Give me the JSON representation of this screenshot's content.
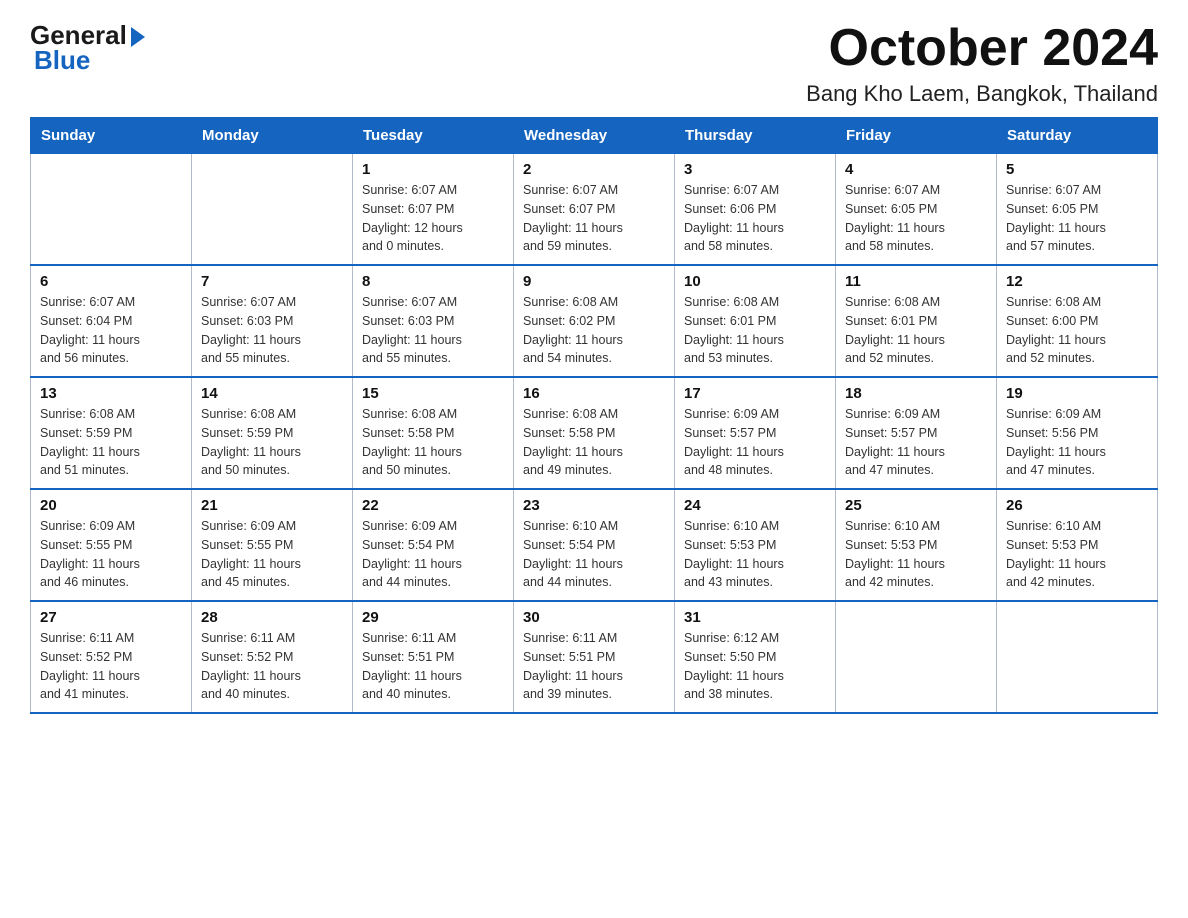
{
  "header": {
    "logo": {
      "text_general": "General",
      "triangle": "▶",
      "text_blue": "Blue"
    },
    "title": "October 2024",
    "subtitle": "Bang Kho Laem, Bangkok, Thailand"
  },
  "calendar": {
    "days_of_week": [
      "Sunday",
      "Monday",
      "Tuesday",
      "Wednesday",
      "Thursday",
      "Friday",
      "Saturday"
    ],
    "weeks": [
      {
        "days": [
          {
            "number": "",
            "info": ""
          },
          {
            "number": "",
            "info": ""
          },
          {
            "number": "1",
            "info": "Sunrise: 6:07 AM\nSunset: 6:07 PM\nDaylight: 12 hours\nand 0 minutes."
          },
          {
            "number": "2",
            "info": "Sunrise: 6:07 AM\nSunset: 6:07 PM\nDaylight: 11 hours\nand 59 minutes."
          },
          {
            "number": "3",
            "info": "Sunrise: 6:07 AM\nSunset: 6:06 PM\nDaylight: 11 hours\nand 58 minutes."
          },
          {
            "number": "4",
            "info": "Sunrise: 6:07 AM\nSunset: 6:05 PM\nDaylight: 11 hours\nand 58 minutes."
          },
          {
            "number": "5",
            "info": "Sunrise: 6:07 AM\nSunset: 6:05 PM\nDaylight: 11 hours\nand 57 minutes."
          }
        ]
      },
      {
        "days": [
          {
            "number": "6",
            "info": "Sunrise: 6:07 AM\nSunset: 6:04 PM\nDaylight: 11 hours\nand 56 minutes."
          },
          {
            "number": "7",
            "info": "Sunrise: 6:07 AM\nSunset: 6:03 PM\nDaylight: 11 hours\nand 55 minutes."
          },
          {
            "number": "8",
            "info": "Sunrise: 6:07 AM\nSunset: 6:03 PM\nDaylight: 11 hours\nand 55 minutes."
          },
          {
            "number": "9",
            "info": "Sunrise: 6:08 AM\nSunset: 6:02 PM\nDaylight: 11 hours\nand 54 minutes."
          },
          {
            "number": "10",
            "info": "Sunrise: 6:08 AM\nSunset: 6:01 PM\nDaylight: 11 hours\nand 53 minutes."
          },
          {
            "number": "11",
            "info": "Sunrise: 6:08 AM\nSunset: 6:01 PM\nDaylight: 11 hours\nand 52 minutes."
          },
          {
            "number": "12",
            "info": "Sunrise: 6:08 AM\nSunset: 6:00 PM\nDaylight: 11 hours\nand 52 minutes."
          }
        ]
      },
      {
        "days": [
          {
            "number": "13",
            "info": "Sunrise: 6:08 AM\nSunset: 5:59 PM\nDaylight: 11 hours\nand 51 minutes."
          },
          {
            "number": "14",
            "info": "Sunrise: 6:08 AM\nSunset: 5:59 PM\nDaylight: 11 hours\nand 50 minutes."
          },
          {
            "number": "15",
            "info": "Sunrise: 6:08 AM\nSunset: 5:58 PM\nDaylight: 11 hours\nand 50 minutes."
          },
          {
            "number": "16",
            "info": "Sunrise: 6:08 AM\nSunset: 5:58 PM\nDaylight: 11 hours\nand 49 minutes."
          },
          {
            "number": "17",
            "info": "Sunrise: 6:09 AM\nSunset: 5:57 PM\nDaylight: 11 hours\nand 48 minutes."
          },
          {
            "number": "18",
            "info": "Sunrise: 6:09 AM\nSunset: 5:57 PM\nDaylight: 11 hours\nand 47 minutes."
          },
          {
            "number": "19",
            "info": "Sunrise: 6:09 AM\nSunset: 5:56 PM\nDaylight: 11 hours\nand 47 minutes."
          }
        ]
      },
      {
        "days": [
          {
            "number": "20",
            "info": "Sunrise: 6:09 AM\nSunset: 5:55 PM\nDaylight: 11 hours\nand 46 minutes."
          },
          {
            "number": "21",
            "info": "Sunrise: 6:09 AM\nSunset: 5:55 PM\nDaylight: 11 hours\nand 45 minutes."
          },
          {
            "number": "22",
            "info": "Sunrise: 6:09 AM\nSunset: 5:54 PM\nDaylight: 11 hours\nand 44 minutes."
          },
          {
            "number": "23",
            "info": "Sunrise: 6:10 AM\nSunset: 5:54 PM\nDaylight: 11 hours\nand 44 minutes."
          },
          {
            "number": "24",
            "info": "Sunrise: 6:10 AM\nSunset: 5:53 PM\nDaylight: 11 hours\nand 43 minutes."
          },
          {
            "number": "25",
            "info": "Sunrise: 6:10 AM\nSunset: 5:53 PM\nDaylight: 11 hours\nand 42 minutes."
          },
          {
            "number": "26",
            "info": "Sunrise: 6:10 AM\nSunset: 5:53 PM\nDaylight: 11 hours\nand 42 minutes."
          }
        ]
      },
      {
        "days": [
          {
            "number": "27",
            "info": "Sunrise: 6:11 AM\nSunset: 5:52 PM\nDaylight: 11 hours\nand 41 minutes."
          },
          {
            "number": "28",
            "info": "Sunrise: 6:11 AM\nSunset: 5:52 PM\nDaylight: 11 hours\nand 40 minutes."
          },
          {
            "number": "29",
            "info": "Sunrise: 6:11 AM\nSunset: 5:51 PM\nDaylight: 11 hours\nand 40 minutes."
          },
          {
            "number": "30",
            "info": "Sunrise: 6:11 AM\nSunset: 5:51 PM\nDaylight: 11 hours\nand 39 minutes."
          },
          {
            "number": "31",
            "info": "Sunrise: 6:12 AM\nSunset: 5:50 PM\nDaylight: 11 hours\nand 38 minutes."
          },
          {
            "number": "",
            "info": ""
          },
          {
            "number": "",
            "info": ""
          }
        ]
      }
    ]
  }
}
